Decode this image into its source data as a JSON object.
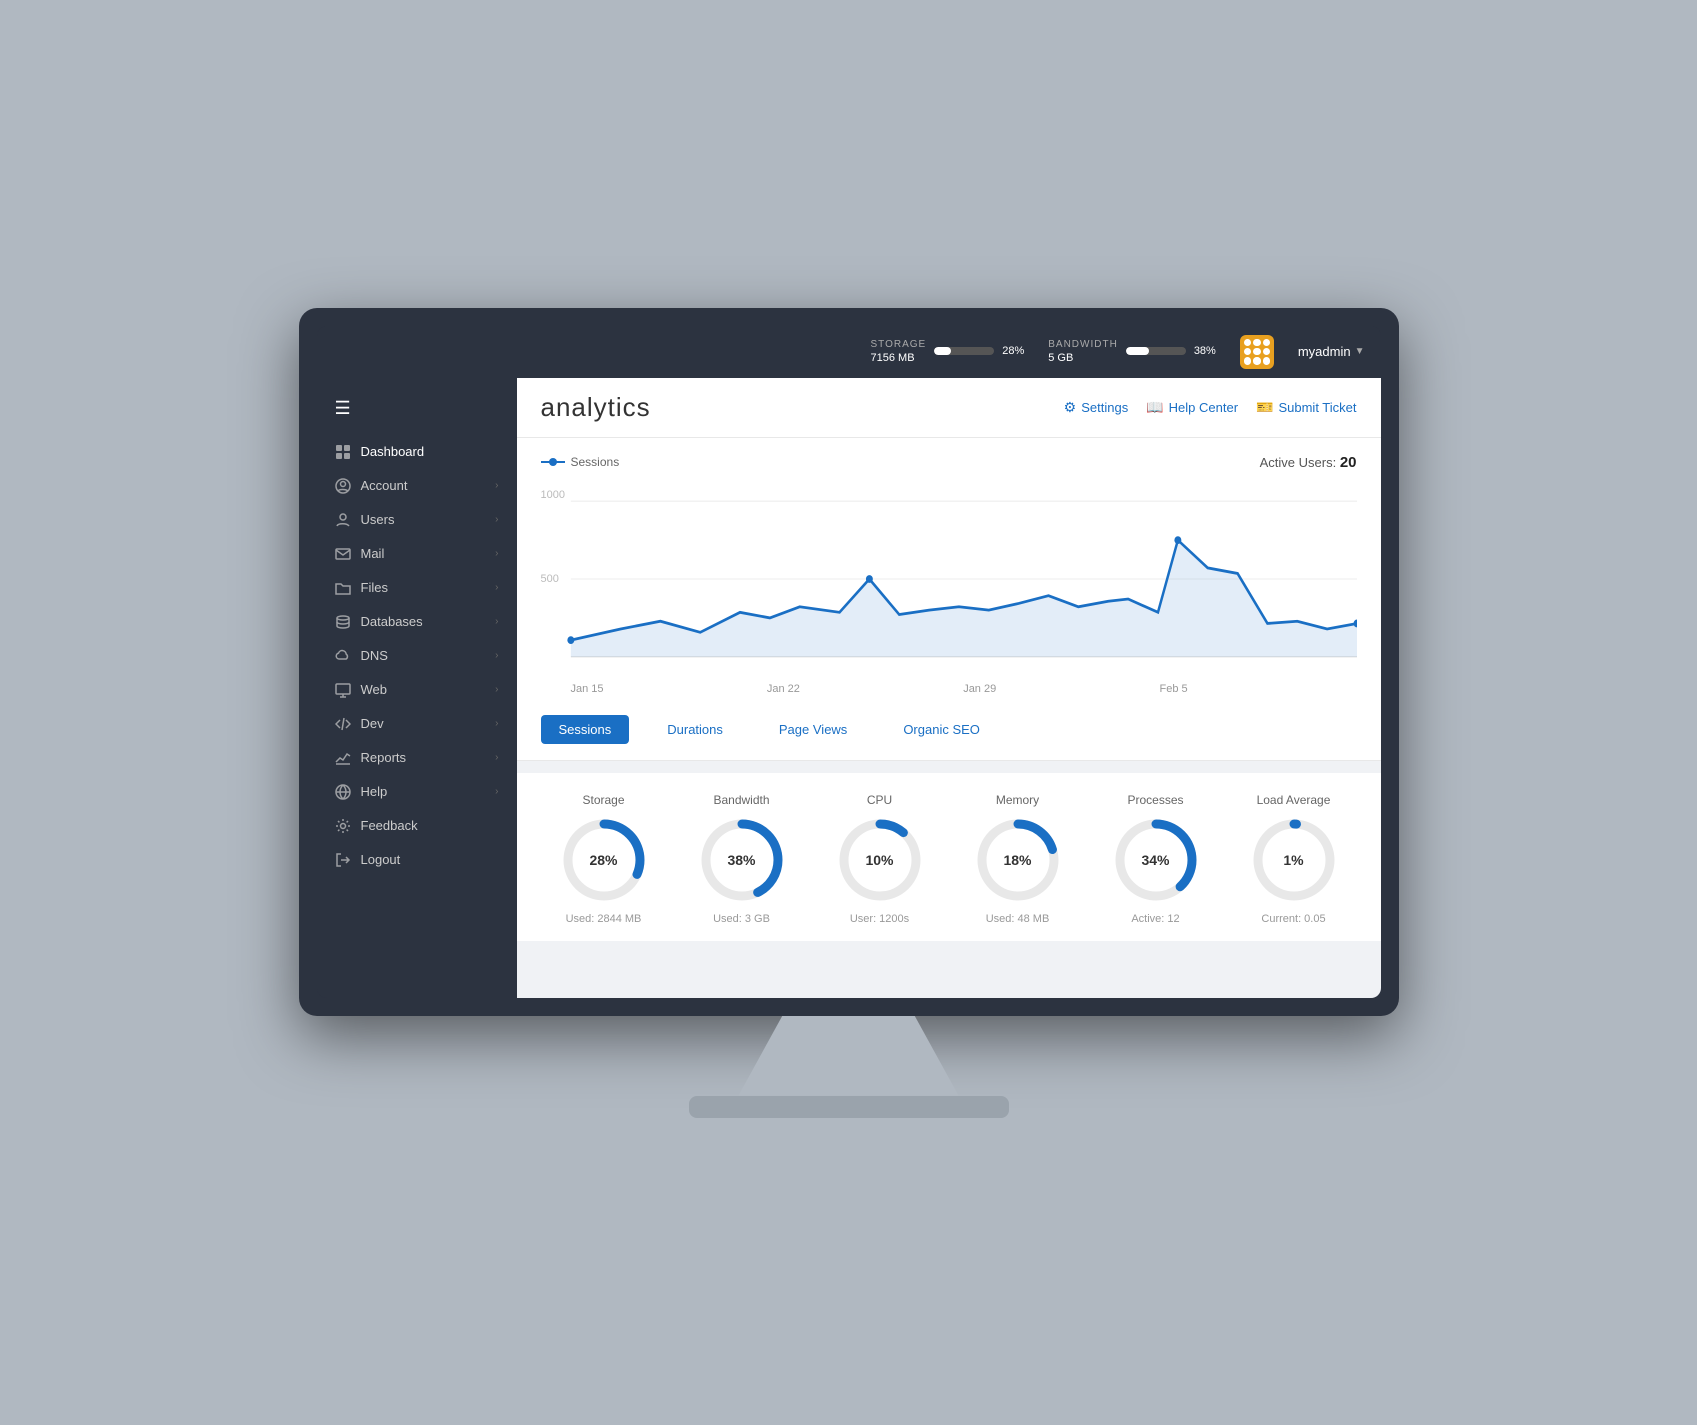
{
  "topbar": {
    "storage_label": "STORAGE",
    "storage_percent": "28%",
    "storage_value": "7156 MB",
    "bandwidth_label": "BANDWIDTH",
    "bandwidth_percent": "38%",
    "bandwidth_value": "5 GB",
    "username": "myadmin"
  },
  "sidebar": {
    "items": [
      {
        "id": "dashboard",
        "label": "Dashboard",
        "icon": "grid",
        "has_chevron": false
      },
      {
        "id": "account",
        "label": "Account",
        "icon": "user-circle",
        "has_chevron": true
      },
      {
        "id": "users",
        "label": "Users",
        "icon": "user",
        "has_chevron": true
      },
      {
        "id": "mail",
        "label": "Mail",
        "icon": "mail",
        "has_chevron": true
      },
      {
        "id": "files",
        "label": "Files",
        "icon": "folder",
        "has_chevron": true
      },
      {
        "id": "databases",
        "label": "Databases",
        "icon": "database",
        "has_chevron": true
      },
      {
        "id": "dns",
        "label": "DNS",
        "icon": "cloud",
        "has_chevron": true
      },
      {
        "id": "web",
        "label": "Web",
        "icon": "monitor",
        "has_chevron": true
      },
      {
        "id": "dev",
        "label": "Dev",
        "icon": "code",
        "has_chevron": true
      },
      {
        "id": "reports",
        "label": "Reports",
        "icon": "chart",
        "has_chevron": true
      },
      {
        "id": "help",
        "label": "Help",
        "icon": "globe",
        "has_chevron": true
      },
      {
        "id": "feedback",
        "label": "Feedback",
        "icon": "settings",
        "has_chevron": false
      },
      {
        "id": "logout",
        "label": "Logout",
        "icon": "logout",
        "has_chevron": false
      }
    ]
  },
  "header": {
    "title": "analytics",
    "settings_label": "Settings",
    "help_label": "Help Center",
    "ticket_label": "Submit Ticket"
  },
  "chart": {
    "sessions_label": "Sessions",
    "active_users_label": "Active Users:",
    "active_users_count": "20",
    "y_max": "1000",
    "y_mid": "500",
    "x_labels": [
      "Jan 15",
      "Jan 22",
      "Jan 29",
      "Feb 5"
    ]
  },
  "tabs": [
    {
      "id": "sessions",
      "label": "Sessions",
      "active": true
    },
    {
      "id": "durations",
      "label": "Durations",
      "active": false
    },
    {
      "id": "pageviews",
      "label": "Page Views",
      "active": false
    },
    {
      "id": "seo",
      "label": "Organic SEO",
      "active": false
    }
  ],
  "stats": [
    {
      "id": "storage",
      "label": "Storage",
      "percent": 28,
      "display": "28%",
      "used": "Used: 2844 MB",
      "color": "#1a6fc4"
    },
    {
      "id": "bandwidth",
      "label": "Bandwidth",
      "percent": 38,
      "display": "38%",
      "used": "Used: 3 GB",
      "color": "#1a6fc4"
    },
    {
      "id": "cpu",
      "label": "CPU",
      "percent": 10,
      "display": "10%",
      "used": "User: 1200s",
      "color": "#1a6fc4"
    },
    {
      "id": "memory",
      "label": "Memory",
      "percent": 18,
      "display": "18%",
      "used": "Used: 48 MB",
      "color": "#1a6fc4"
    },
    {
      "id": "processes",
      "label": "Processes",
      "percent": 34,
      "display": "34%",
      "used": "Active: 12",
      "color": "#1a6fc4"
    },
    {
      "id": "load",
      "label": "Load Average",
      "percent": 1,
      "display": "1%",
      "used": "Current: 0.05",
      "color": "#1a6fc4"
    }
  ]
}
